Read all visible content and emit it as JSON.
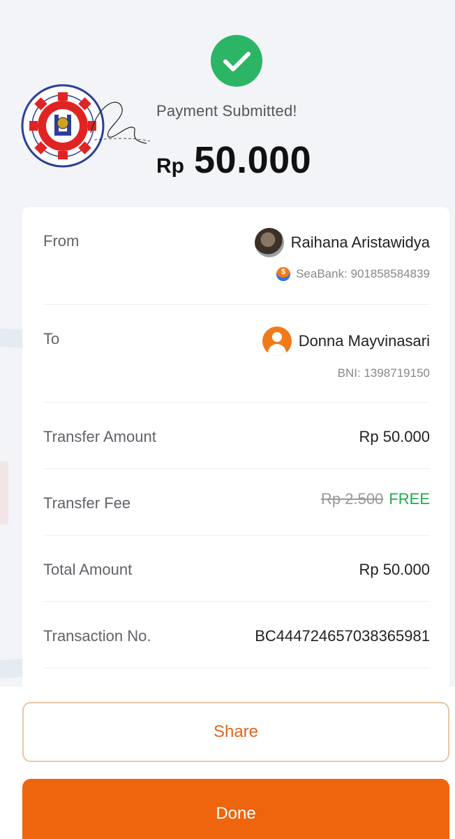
{
  "status": {
    "message": "Payment Submitted!",
    "currency": "Rp",
    "amount": "50.000",
    "icon": "check-circle-icon",
    "color": "#2bb565"
  },
  "details": {
    "from": {
      "label": "From",
      "name": "Raihana Aristawidya",
      "account": "SeaBank: 901858584839"
    },
    "to": {
      "label": "To",
      "name": "Donna Mayvinasari",
      "account": "BNI: 1398719150"
    },
    "transfer_amount": {
      "label": "Transfer Amount",
      "value": "Rp 50.000"
    },
    "transfer_fee": {
      "label": "Transfer Fee",
      "original": "Rp 2.500",
      "value": "FREE"
    },
    "total_amount": {
      "label": "Total Amount",
      "value": "Rp 50.000"
    },
    "transaction_no": {
      "label": "Transaction No.",
      "value": "BC444724657038365981"
    }
  },
  "actions": {
    "share_label": "Share",
    "done_label": "Done"
  },
  "colors": {
    "primary": "#ef650d",
    "success": "#2bb565",
    "free": "#1faa4a",
    "background": "#f2f4f7"
  }
}
